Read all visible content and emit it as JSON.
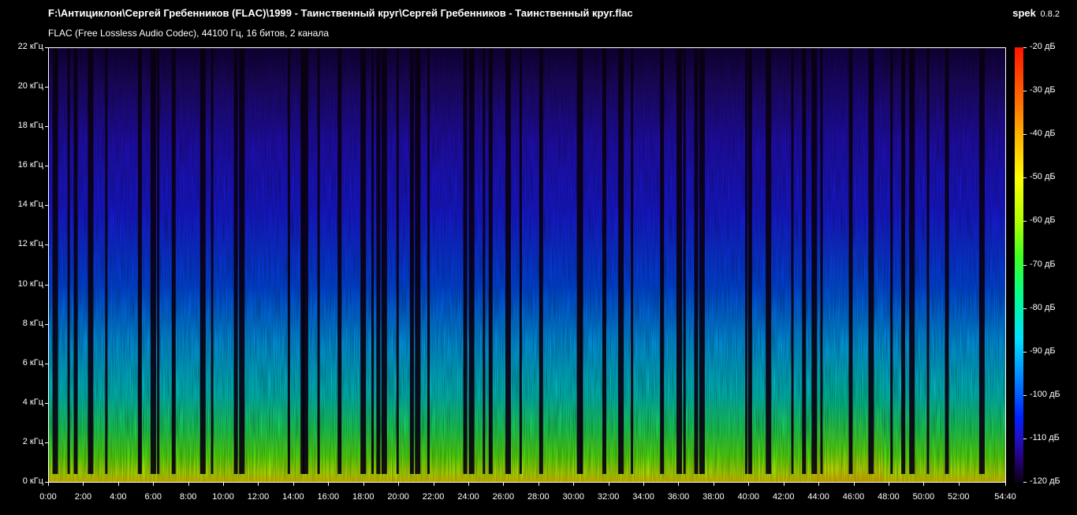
{
  "header": {
    "file_path": "F:\\Антициклон\\Сергей Гребенников (FLAC)\\1999 - Таинственный круг\\Сергей Гребенников - Таинственный круг.flac",
    "format_info": "FLAC (Free Lossless Audio Codec), 44100 Гц, 16 битов, 2 канала"
  },
  "brand": {
    "name": "spek",
    "version": "0.8.2"
  },
  "spectrogram": {
    "y_ticks": [
      "22 кГц",
      "20 кГц",
      "18 кГц",
      "16 кГц",
      "14 кГц",
      "12 кГц",
      "10 кГц",
      "8 кГц",
      "6 кГц",
      "4 кГц",
      "2 кГц",
      "0 кГц"
    ],
    "x_ticks": [
      "0:00",
      "2:00",
      "4:00",
      "6:00",
      "8:00",
      "10:00",
      "12:00",
      "14:00",
      "16:00",
      "18:00",
      "20:00",
      "22:00",
      "24:00",
      "26:00",
      "28:00",
      "30:00",
      "32:00",
      "34:00",
      "36:00",
      "38:00",
      "40:00",
      "42:00",
      "44:00",
      "46:00",
      "48:00",
      "50:00",
      "52:00",
      "54:40"
    ],
    "x_tick_seconds": [
      0,
      120,
      240,
      360,
      480,
      600,
      720,
      840,
      960,
      1080,
      1200,
      1320,
      1440,
      1560,
      1680,
      1800,
      1920,
      2040,
      2160,
      2280,
      2400,
      2520,
      2640,
      2760,
      2880,
      3000,
      3120,
      3280
    ],
    "duration_seconds": 3280,
    "track_gaps_seconds": [
      22,
      68,
      92,
      143,
      197,
      312,
      358,
      375,
      428,
      528,
      560,
      641,
      662,
      823,
      870,
      880,
      925,
      997,
      1078,
      1110,
      1130,
      1150,
      1196,
      1245,
      1265,
      1302,
      1428,
      1450,
      1492,
      1515,
      1575,
      1618,
      1688,
      1820,
      1828,
      1905,
      1962,
      2000,
      2103,
      2162,
      2180,
      2220,
      2240,
      2392,
      2405,
      2468,
      2550,
      2590,
      2625,
      2650,
      2750,
      2820,
      2890,
      2930,
      2960,
      3015,
      3080,
      3200
    ]
  },
  "colorbar": {
    "ticks": [
      "-20 дБ",
      "-30 дБ",
      "-40 дБ",
      "-50 дБ",
      "-60 дБ",
      "-70 дБ",
      "-80 дБ",
      "-90 дБ",
      "-100 дБ",
      "-110 дБ",
      "-120 дБ"
    ]
  },
  "colors": {
    "background": "#000000",
    "text": "#ffffff",
    "low": "#0a0010",
    "high": "#ff1500"
  }
}
